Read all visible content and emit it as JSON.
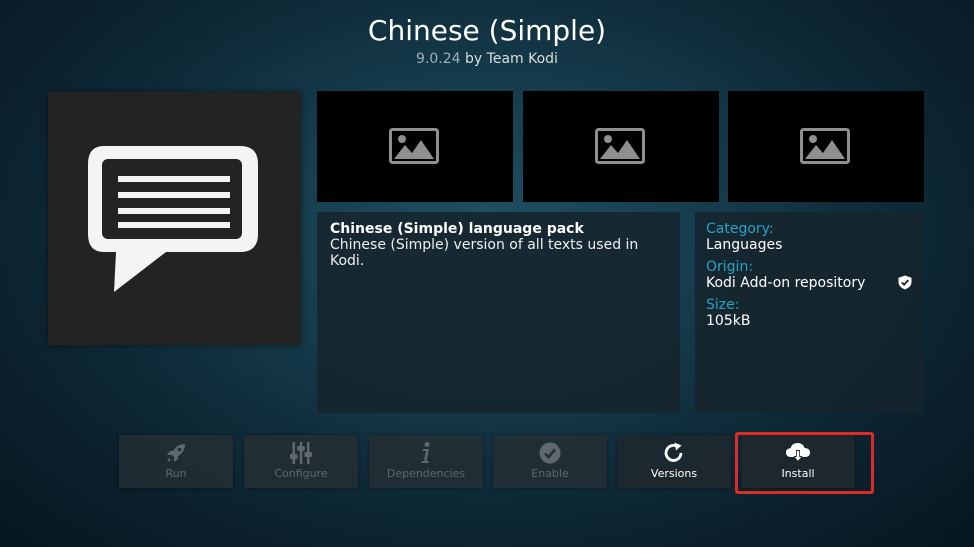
{
  "header": {
    "title": "Chinese (Simple)",
    "version": "9.0.24",
    "author_text": "by Team Kodi"
  },
  "poster": {
    "icon": "speech-bubble-icon"
  },
  "screenshots": [
    {
      "icon": "image-placeholder-icon"
    },
    {
      "icon": "image-placeholder-icon"
    },
    {
      "icon": "image-placeholder-icon"
    }
  ],
  "description": {
    "title": "Chinese (Simple) language pack",
    "line1": "Chinese (Simple) version of all texts used in",
    "line2": "Kodi."
  },
  "info": {
    "category_label": "Category:",
    "category_value": "Languages",
    "origin_label": "Origin:",
    "origin_value": "Kodi Add-on repository",
    "origin_badge_icon": "shield-check-icon",
    "size_label": "Size:",
    "size_value": "105kB"
  },
  "buttons": {
    "run": {
      "label": "Run",
      "icon": "rocket-icon",
      "enabled": false
    },
    "configure": {
      "label": "Configure",
      "icon": "sliders-icon",
      "enabled": false
    },
    "dependencies": {
      "label": "Dependencies",
      "icon": "info-icon",
      "enabled": false
    },
    "enable": {
      "label": "Enable",
      "icon": "check-circle-icon",
      "enabled": false
    },
    "versions": {
      "label": "Versions",
      "icon": "refresh-icon",
      "enabled": true
    },
    "install": {
      "label": "Install",
      "icon": "cloud-download-icon",
      "enabled": true
    }
  },
  "colors": {
    "accent": "#27a3c8",
    "highlight": "#e02a27",
    "disabled_text": "#5e686e"
  }
}
